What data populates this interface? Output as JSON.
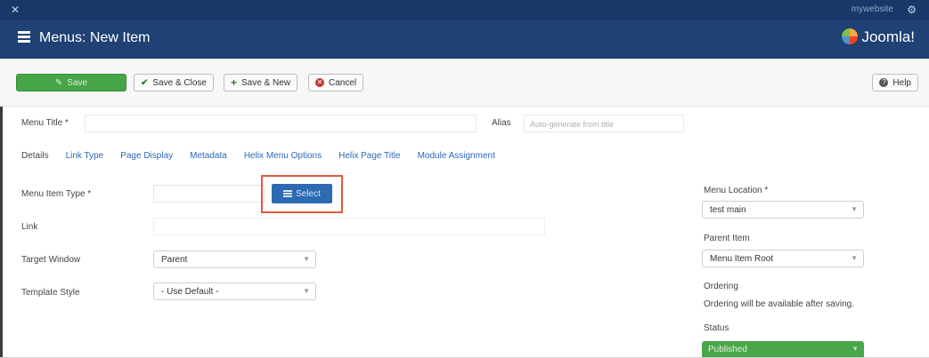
{
  "topbar": {
    "site_link": "mywebsite"
  },
  "header": {
    "title": "Menus: New Item",
    "brand": "Joomla!"
  },
  "toolbar": {
    "save": "Save",
    "save_close": "Save & Close",
    "save_new": "Save & New",
    "cancel": "Cancel",
    "help": "Help"
  },
  "form": {
    "menu_title_label": "Menu Title *",
    "alias_label": "Alias",
    "alias_placeholder": "Auto-generate from title"
  },
  "tabs": [
    {
      "label": "Details",
      "active": true
    },
    {
      "label": "Link Type"
    },
    {
      "label": "Page Display"
    },
    {
      "label": "Metadata"
    },
    {
      "label": "Helix Menu Options"
    },
    {
      "label": "Helix Page Title"
    },
    {
      "label": "Module Assignment"
    }
  ],
  "details": {
    "menu_item_type_label": "Menu Item Type *",
    "select_button": "Select",
    "link_label": "Link",
    "target_window_label": "Target Window",
    "target_window_value": "Parent",
    "template_style_label": "Template Style",
    "template_style_value": "- Use Default -"
  },
  "side": {
    "menu_location_label": "Menu Location *",
    "menu_location_value": "test main",
    "parent_item_label": "Parent Item",
    "parent_item_value": "Menu Item Root",
    "ordering_label": "Ordering",
    "ordering_note": "Ordering will be available after saving.",
    "status_label": "Status",
    "status_value": "Published"
  },
  "colors": {
    "topbar": "#1a3867",
    "header": "#1f4173",
    "save_green": "#46a546",
    "select_blue": "#2d6ab4",
    "highlight": "#e05a3c"
  }
}
